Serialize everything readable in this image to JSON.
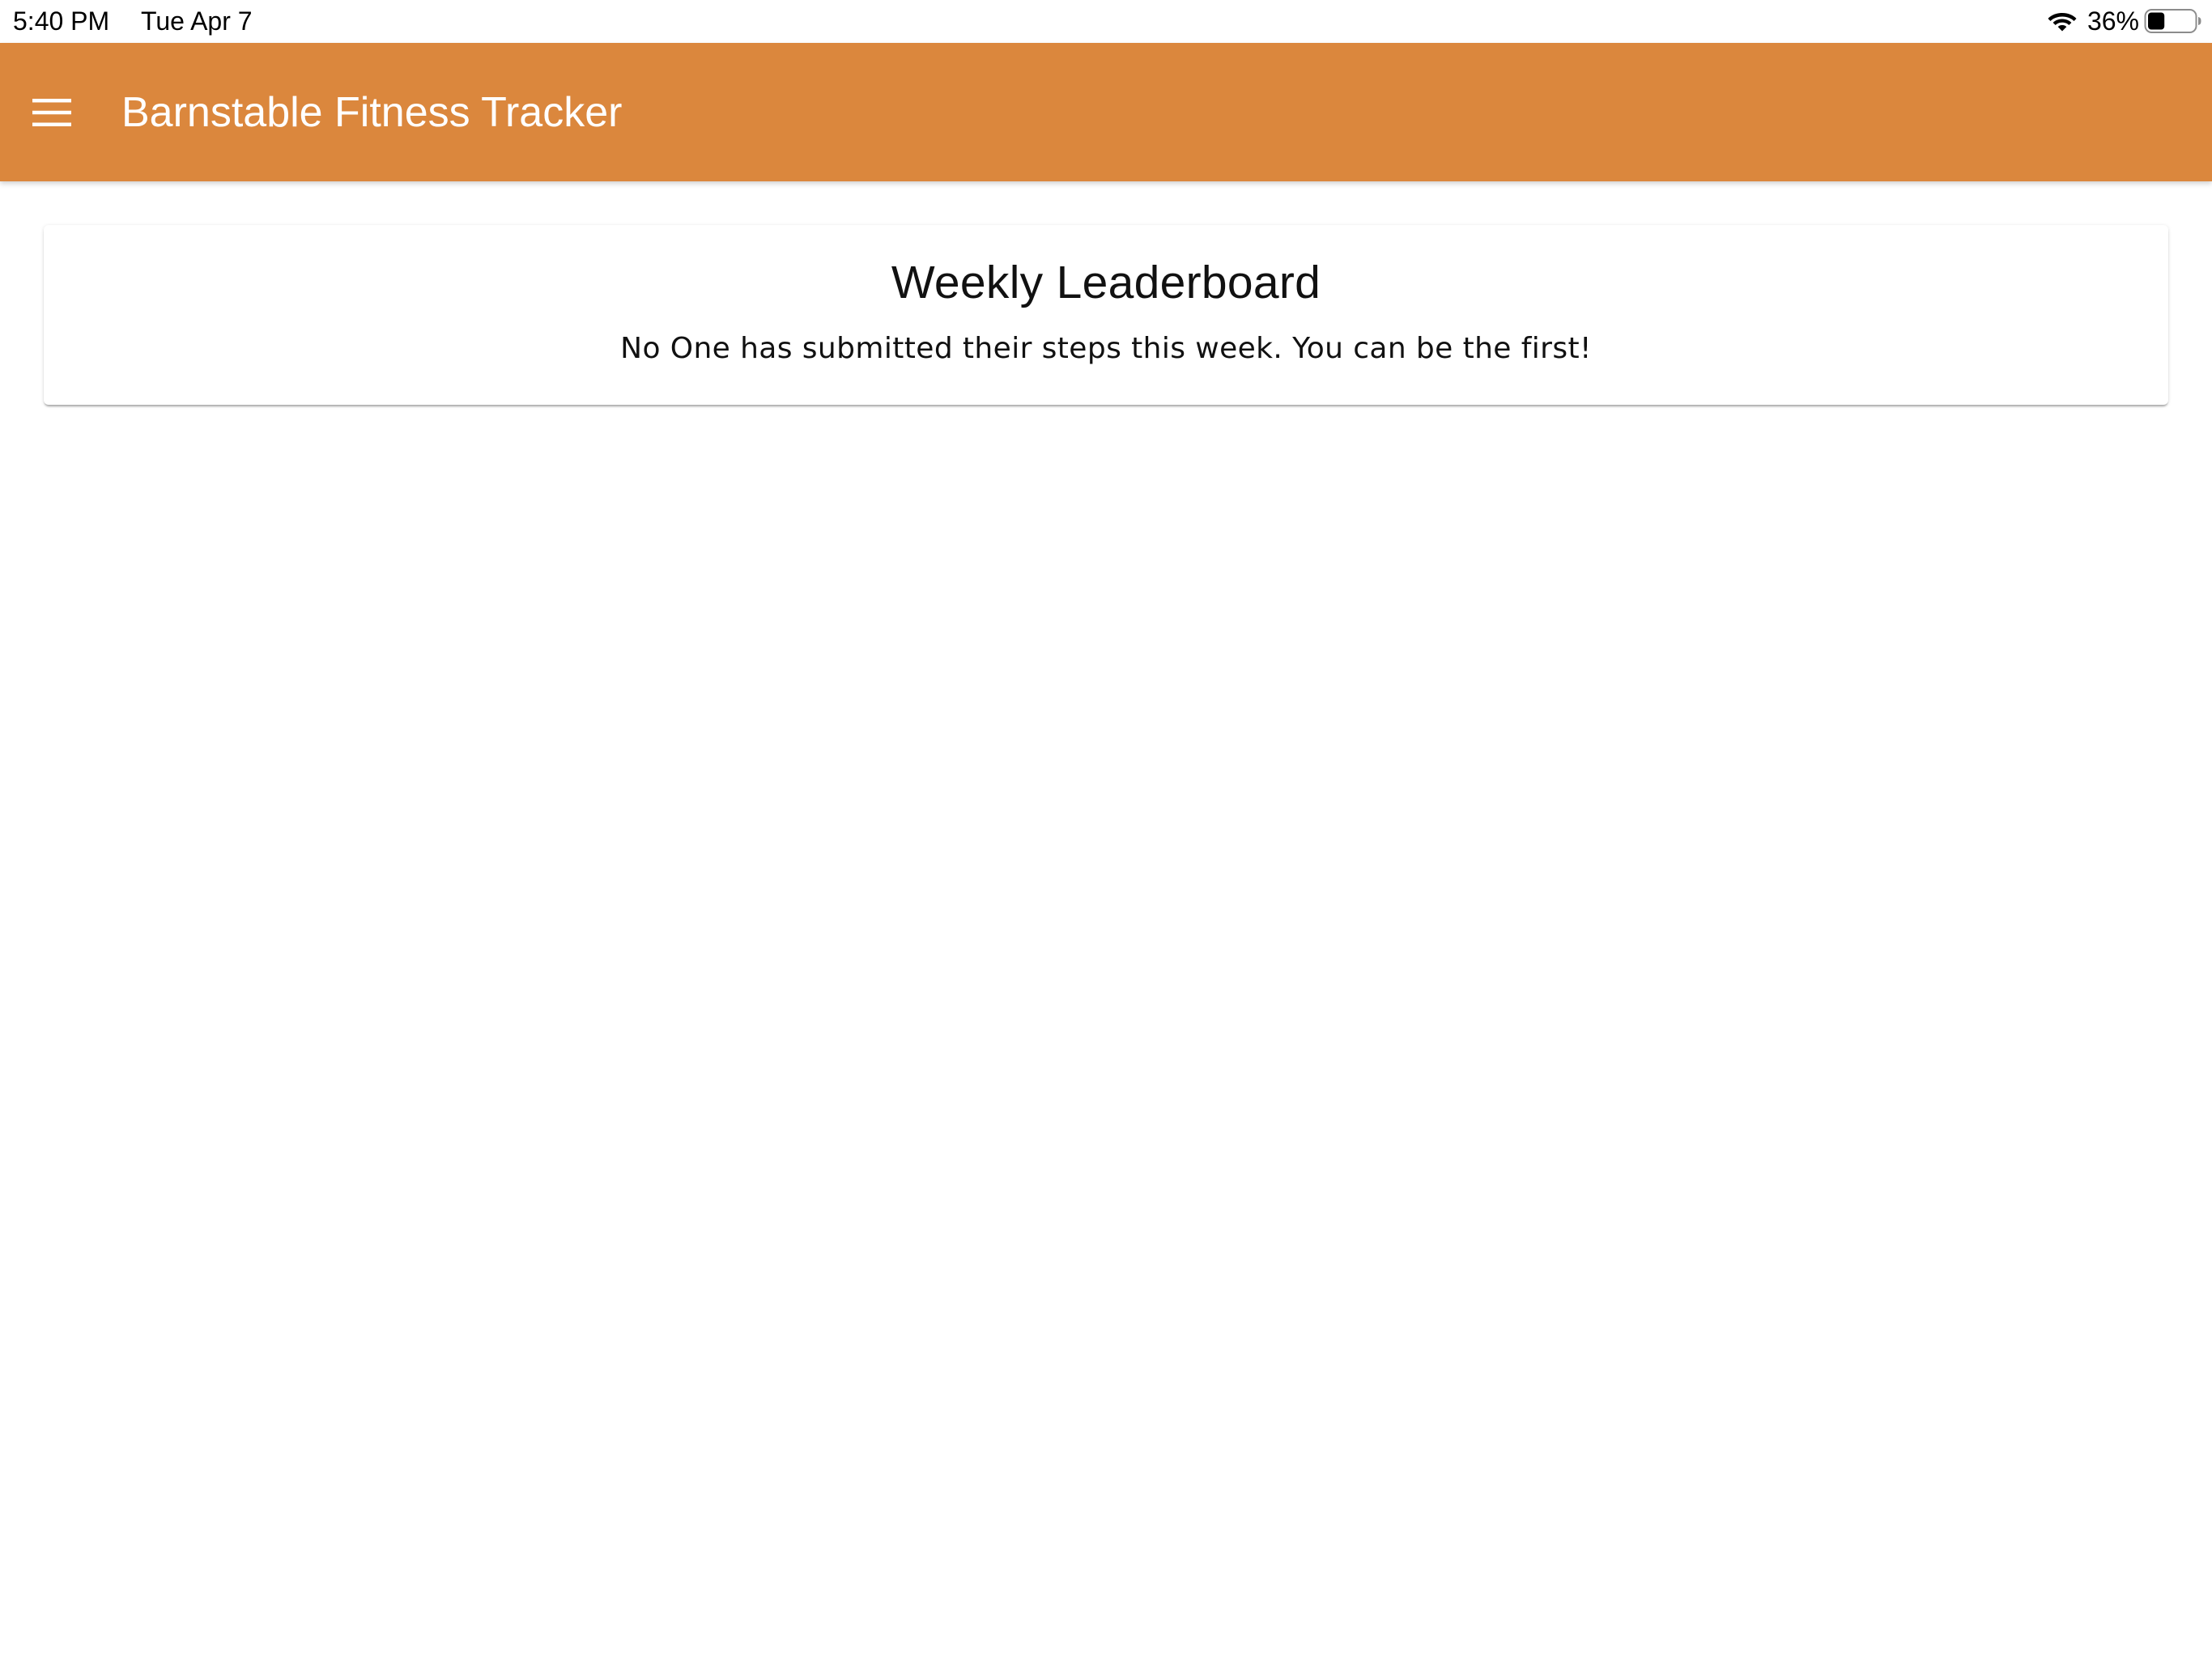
{
  "status_bar": {
    "time": "5:40 PM",
    "date": "Tue Apr 7",
    "wifi_icon": "wifi-icon",
    "battery_percent": "36%",
    "battery_level": 0.36,
    "battery_icon": "battery-icon"
  },
  "app_bar": {
    "menu_icon": "hamburger-menu-icon",
    "title": "Barnstable Fitness Tracker",
    "background_color": "#DB873D",
    "text_color": "#FFFFFF"
  },
  "leaderboard": {
    "title": "Weekly Leaderboard",
    "empty_message": "No One has submitted their steps this week. You can be the first!"
  }
}
